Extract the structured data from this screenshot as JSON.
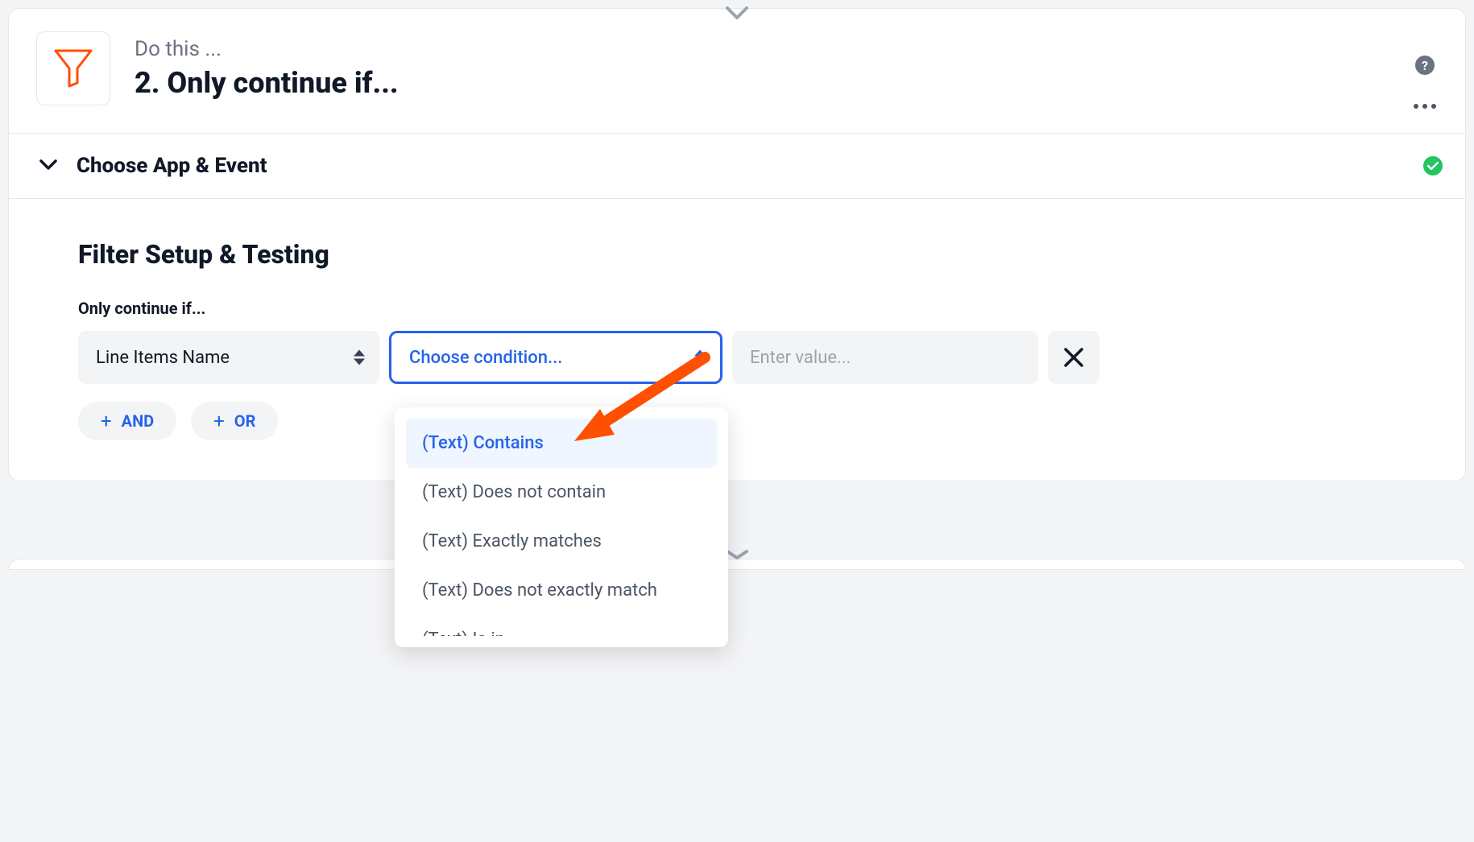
{
  "header": {
    "subtitle": "Do this ...",
    "title": "2. Only continue if..."
  },
  "sections": {
    "collapsed_title": "Choose App & Event",
    "setup_title": "Filter Setup & Testing",
    "continue_label": "Only continue if..."
  },
  "fields": {
    "field_value": "Line Items Name",
    "condition_placeholder": "Choose condition...",
    "value_placeholder": "Enter value..."
  },
  "buttons": {
    "and_label": "AND",
    "or_label": "OR"
  },
  "dropdown": {
    "options": [
      "(Text) Contains",
      "(Text) Does not contain",
      "(Text) Exactly matches",
      "(Text) Does not exactly match",
      "(Text) Is in"
    ]
  },
  "icons": {
    "help": "?",
    "plus": "+"
  }
}
